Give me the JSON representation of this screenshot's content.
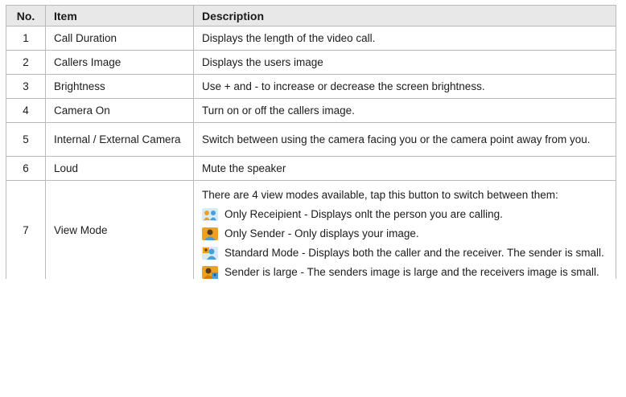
{
  "table": {
    "headers": {
      "no": "No.",
      "item": "Item",
      "description": "Description"
    },
    "rows": [
      {
        "no": "1",
        "item": "Call Duration",
        "description": "Displays the length of the video call."
      },
      {
        "no": "2",
        "item": "Callers Image",
        "description": "Displays the users image"
      },
      {
        "no": "3",
        "item": "Brightness",
        "description": "Use + and  - to increase or decrease the screen brightness."
      },
      {
        "no": "4",
        "item": "Camera On",
        "description": "Turn on or off the callers image."
      },
      {
        "no": "5",
        "item": "Internal / External Camera",
        "description": "Switch between using the camera facing you or the camera point away from you."
      },
      {
        "no": "6",
        "item": "Loud",
        "description": "Mute the speaker"
      },
      {
        "no": "7",
        "item": "View Mode",
        "intro": "There are 4 view modes available, tap this button to switch between them:",
        "modes": [
          {
            "icon": "recipient-view-icon",
            "text": "Only Receipient - Displays onlt the person you are calling."
          },
          {
            "icon": "sender-view-icon",
            "text": "Only Sender - Only displays your image."
          },
          {
            "icon": "standard-view-icon",
            "text": "Standard Mode - Displays both the caller and the receiver. The sender is small."
          },
          {
            "icon": "sender-large-view-icon",
            "text": "Sender is large -  The senders image is large and the receivers image is small."
          }
        ]
      }
    ]
  },
  "colors": {
    "header_bg": "#e8e8e8",
    "border": "#b9b9b9",
    "icon_orange": "#f0a020",
    "icon_blue": "#4a9fd8"
  }
}
